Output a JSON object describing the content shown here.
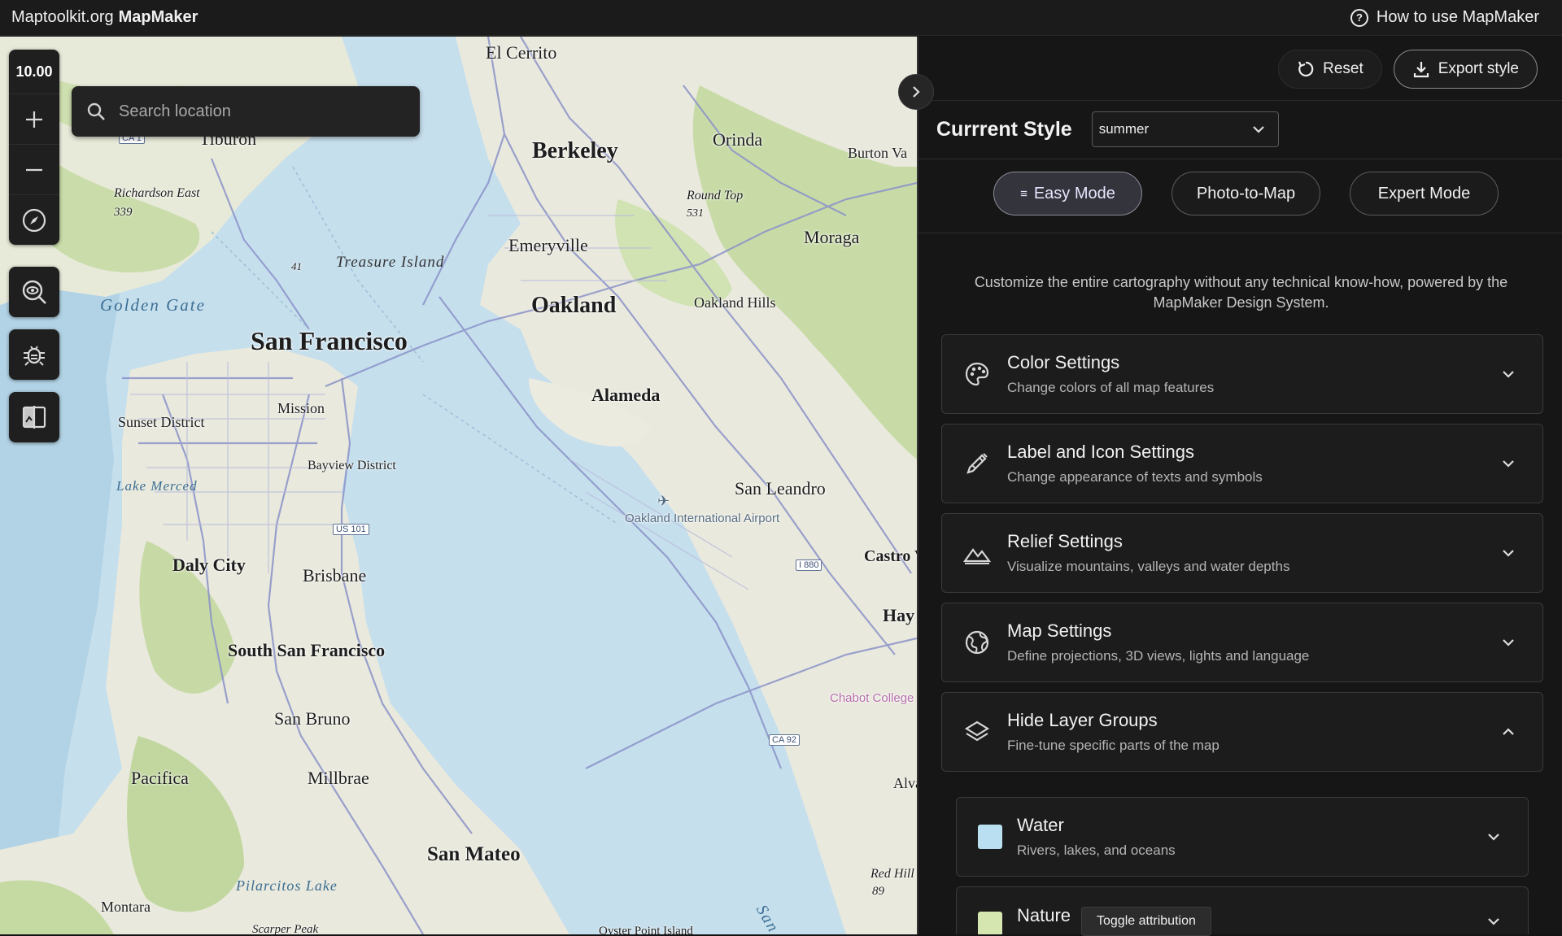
{
  "topbar": {
    "brand_prefix": "Maptoolkit.org",
    "brand_name": "MapMaker",
    "help_label": "How to use MapMaker"
  },
  "map": {
    "zoom_level": "10.00",
    "search_placeholder": "Search location",
    "labels": {
      "el_cerrito": "El Cerrito",
      "tiburon": "Tiburon",
      "berkeley": "Berkeley",
      "orinda": "Orinda",
      "burton": "Burton Va",
      "richardson": "Richardson East",
      "richardson_num": "339",
      "round_top": "Round Top",
      "round_top_num": "531",
      "moraga": "Moraga",
      "emeryville": "Emeryville",
      "treasure_island": "Treasure Island",
      "num_41": "41",
      "golden_gate": "Golden Gate",
      "oakland": "Oakland",
      "oakland_hills": "Oakland Hills",
      "san_francisco": "San Francisco",
      "mission": "Mission",
      "alameda": "Alameda",
      "sunset": "Sunset District",
      "bayview": "Bayview District",
      "lake_merced": "Lake Merced",
      "san_leandro": "San Leandro",
      "airport": "Oakland International Airport",
      "castro": "Castro V",
      "daly_city": "Daly City",
      "brisbane": "Brisbane",
      "hay": "Hay",
      "ssf": "South San Francisco",
      "chabot": "Chabot College",
      "san_bruno": "San Bruno",
      "pacifica": "Pacifica",
      "millbrae": "Millbrae",
      "alva": "Alva",
      "san_mateo": "San Mateo",
      "red_hill": "Red Hill",
      "red_hill_num": "89",
      "pilarcitos": "Pilarcitos Lake",
      "montara": "Montara",
      "scarper": "Scarper Peak",
      "san_partial": "San",
      "oyster": "Oyster Point Island"
    },
    "shields": {
      "ca1": "CA 1",
      "us101": "US 101",
      "i880": "I 880",
      "ca92": "CA 92"
    }
  },
  "panel": {
    "reset_label": "Reset",
    "export_label": "Export style",
    "style_title": "Currrent Style",
    "style_value": "summer",
    "modes": [
      {
        "label": "Easy Mode",
        "active": true
      },
      {
        "label": "Photo-to-Map",
        "active": false
      },
      {
        "label": "Expert Mode",
        "active": false
      }
    ],
    "intro": "Customize the entire cartography without any technical know-how, powered by the MapMaker Design System.",
    "sections": [
      {
        "title": "Color Settings",
        "subtitle": "Change colors of all map features",
        "icon": "palette-icon",
        "expanded": false
      },
      {
        "title": "Label and Icon Settings",
        "subtitle": "Change appearance of texts and symbols",
        "icon": "pen-icon",
        "expanded": false
      },
      {
        "title": "Relief Settings",
        "subtitle": "Visualize mountains, valleys and water depths",
        "icon": "mountain-icon",
        "expanded": false
      },
      {
        "title": "Map Settings",
        "subtitle": "Define projections, 3D views, lights and language",
        "icon": "globe-icon",
        "expanded": false
      },
      {
        "title": "Hide Layer Groups",
        "subtitle": "Fine-tune specific parts of the map",
        "icon": "layers-icon",
        "expanded": true
      }
    ],
    "layer_groups": [
      {
        "title": "Water",
        "subtitle": "Rivers, lakes, and oceans",
        "color": "#b9dff0"
      },
      {
        "title": "Nature",
        "subtitle": "",
        "color": "#d5e6b0"
      }
    ],
    "tooltip": "Toggle attribution"
  }
}
